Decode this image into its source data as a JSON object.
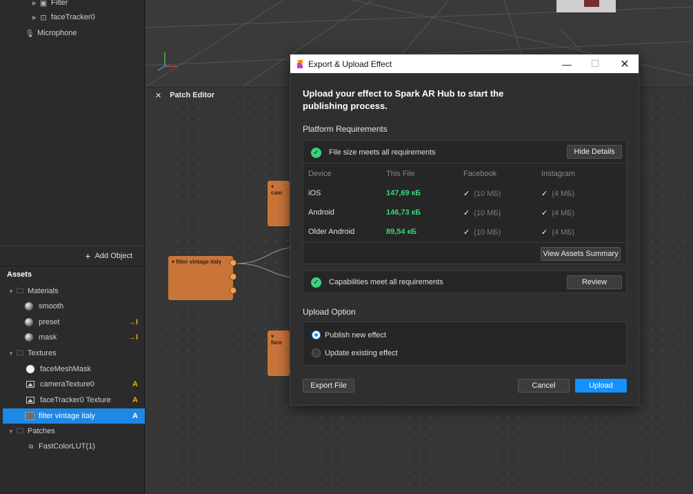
{
  "scene_tree": [
    {
      "label": "Filter",
      "icon": "filter-icon"
    },
    {
      "label": "faceTracker0",
      "icon": "face-tracker-icon"
    },
    {
      "label": "Microphone",
      "icon": "microphone-icon"
    }
  ],
  "add_object_label": "Add Object",
  "assets": {
    "header": "Assets",
    "materials_label": "Materials",
    "materials": [
      {
        "label": "smooth",
        "tag": ""
      },
      {
        "label": "preset",
        "tag": "→I"
      },
      {
        "label": "mask",
        "tag": "→I"
      }
    ],
    "textures_label": "Textures",
    "textures": [
      {
        "label": "faceMeshMask",
        "tag": ""
      },
      {
        "label": "cameraTexture0",
        "tag": "A"
      },
      {
        "label": "faceTracker0 Texture",
        "tag": "A"
      },
      {
        "label": "filter vintage italy",
        "tag": "A"
      }
    ],
    "patches_label": "Patches",
    "patches": [
      {
        "label": "FastColorLUT(1)"
      }
    ]
  },
  "patch_editor": {
    "tab_label": "Patch Editor",
    "nodes": [
      "filter vintage italy",
      "cam",
      "face"
    ]
  },
  "dialog": {
    "title": "Export & Upload Effect",
    "heading": "Upload your effect to Spark AR Hub to start the publishing process.",
    "platform_requirements_label": "Platform Requirements",
    "file_size_status": "File size meets all requirements",
    "hide_details_label": "Hide Details",
    "table": {
      "headers": [
        "Device",
        "This File",
        "Facebook",
        "Instagram"
      ],
      "rows": [
        {
          "device": "iOS",
          "size": "147,69 кБ",
          "facebook": "(10 МБ)",
          "instagram": "(4 МБ)"
        },
        {
          "device": "Android",
          "size": "146,73 кБ",
          "facebook": "(10 МБ)",
          "instagram": "(4 МБ)"
        },
        {
          "device": "Older Android",
          "size": "89,54 кБ",
          "facebook": "(10 МБ)",
          "instagram": "(4 МБ)"
        }
      ]
    },
    "view_assets_summary_label": "View Assets Summary",
    "capabilities_status": "Capabilities meet all requirements",
    "review_label": "Review",
    "upload_option_label": "Upload Option",
    "options": [
      {
        "label": "Publish new effect",
        "selected": true
      },
      {
        "label": "Update existing effect",
        "selected": false
      }
    ],
    "export_file_label": "Export File",
    "cancel_label": "Cancel",
    "upload_label": "Upload"
  },
  "colors": {
    "accent": "#1592ff",
    "success": "#37d67a",
    "patch_node": "#c9753a",
    "selected_row": "#1e88e5"
  }
}
